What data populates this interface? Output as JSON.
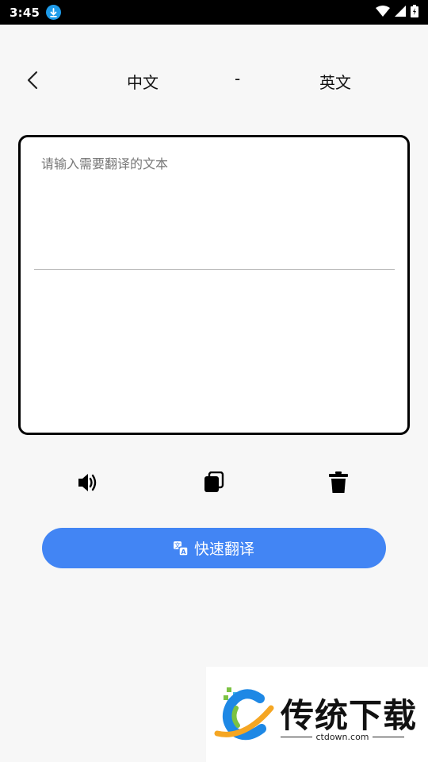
{
  "status_bar": {
    "time": "3:45"
  },
  "header": {
    "source_lang": "中文",
    "separator": "-",
    "target_lang": "英文"
  },
  "input": {
    "placeholder": "请输入需要翻译的文本",
    "value": ""
  },
  "output": {
    "text": ""
  },
  "translate_button": {
    "label": "快速翻译"
  },
  "watermark": {
    "brand": "传统下载",
    "domain": "ctdown.com"
  },
  "colors": {
    "accent": "#4285f4",
    "status_bar": "#000000",
    "download_icon": "#1e9be9",
    "background": "#f7f7f7"
  },
  "icons": {
    "back": "chevron-left-icon",
    "speak": "speaker-icon",
    "copy": "copy-icon",
    "delete": "trash-icon",
    "translate": "translate-icon"
  }
}
